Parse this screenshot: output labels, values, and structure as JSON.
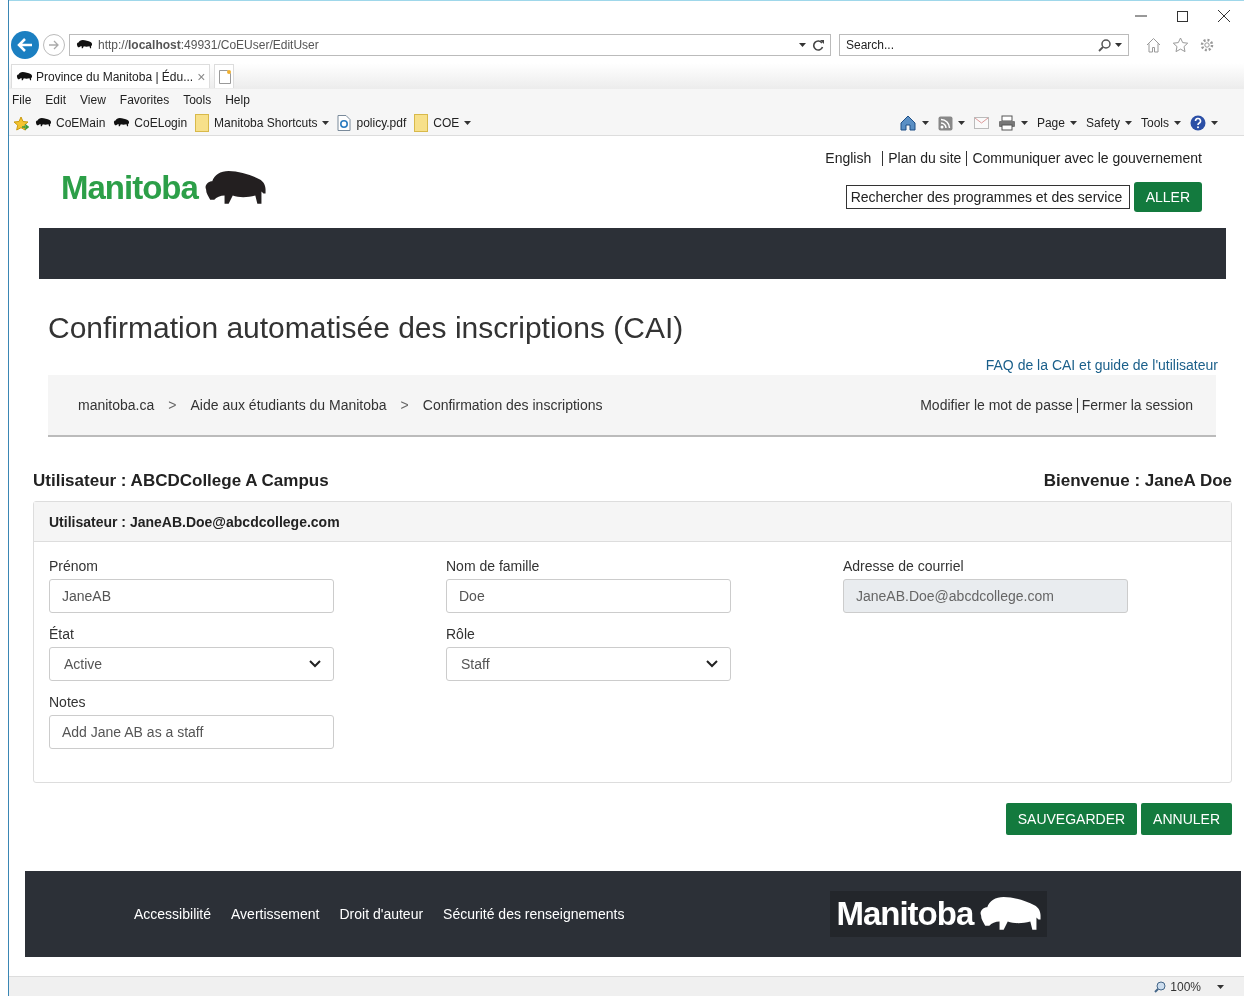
{
  "browser": {
    "url": "http://**localhost**:49931/CoEUser/EditUser",
    "search_placeholder": "Search...",
    "tab": {
      "title": "Province du Manitoba | Édu...",
      "close": "×"
    },
    "menu": [
      "File",
      "Edit",
      "View",
      "Favorites",
      "Tools",
      "Help"
    ],
    "favorites": [
      {
        "kind": "bison",
        "label": "CoEMain",
        "dropdown": false
      },
      {
        "kind": "bison",
        "label": "CoELogin",
        "dropdown": false
      },
      {
        "kind": "folder",
        "label": "Manitoba Shortcuts",
        "dropdown": true
      },
      {
        "kind": "page",
        "label": "policy.pdf",
        "dropdown": false
      },
      {
        "kind": "folder",
        "label": "COE",
        "dropdown": true
      }
    ],
    "command_bar": [
      {
        "kind": "home",
        "dropdown": true
      },
      {
        "kind": "feeds",
        "dropdown": true
      },
      {
        "kind": "mail",
        "dropdown": false
      },
      {
        "kind": "print",
        "dropdown": true
      },
      {
        "kind": "menu",
        "label": "Page",
        "dropdown": true
      },
      {
        "kind": "menu",
        "label": "Safety",
        "dropdown": true
      },
      {
        "kind": "menu",
        "label": "Tools",
        "dropdown": true
      },
      {
        "kind": "help",
        "dropdown": true
      }
    ],
    "zoom": "100%"
  },
  "header": {
    "logo": "Manitoba",
    "links": [
      "English",
      "Plan du site",
      "Communiquer avec le gouvernement"
    ],
    "search_value": "Rechercher des programmes et des service",
    "search_button": "ALLER"
  },
  "page": {
    "title": "Confirmation automatisée des inscriptions (CAI)",
    "help_link": "FAQ de la CAI et guide de l'utilisateur",
    "breadcrumb": [
      {
        "kind": "link",
        "label": "manitoba.ca"
      },
      {
        "kind": "separator",
        "label": ">"
      },
      {
        "kind": "link",
        "label": "Aide aux étudiants du Manitoba"
      },
      {
        "kind": "separator",
        "label": ">"
      },
      {
        "kind": "link",
        "label": "Confirmation des inscriptions"
      }
    ],
    "account_links": [
      "Modifier le mot de passe",
      "Fermer la session"
    ],
    "user": "Utilisateur : ABCDCollege A Campus",
    "welcome": "Bienvenue : JaneA Doe"
  },
  "form": {
    "header": "Utilisateur : JaneAB.Doe@abcdcollege.com",
    "rows": [
      [
        {
          "label": "Prénom",
          "kind": "text",
          "value": "JaneAB",
          "disabled": false
        },
        {
          "label": "Nom de famille",
          "kind": "text",
          "value": "Doe",
          "disabled": false
        },
        {
          "label": "Adresse de courriel",
          "kind": "text",
          "value": "JaneAB.Doe@abcdcollege.com",
          "disabled": true
        }
      ],
      [
        {
          "label": "État",
          "kind": "select",
          "value": "Active",
          "disabled": false
        },
        {
          "label": "Rôle",
          "kind": "select",
          "value": "Staff",
          "disabled": false
        }
      ],
      [
        {
          "label": "Notes",
          "kind": "text",
          "value": "Add Jane AB as a staff",
          "disabled": false
        }
      ]
    ],
    "buttons": [
      "SAUVEGARDER",
      "ANNULER"
    ]
  },
  "footer": {
    "links": [
      "Accessibilité",
      "Avertissement",
      "Droit d'auteur",
      "Sécurité des renseignements"
    ],
    "logo": "Manitoba"
  }
}
